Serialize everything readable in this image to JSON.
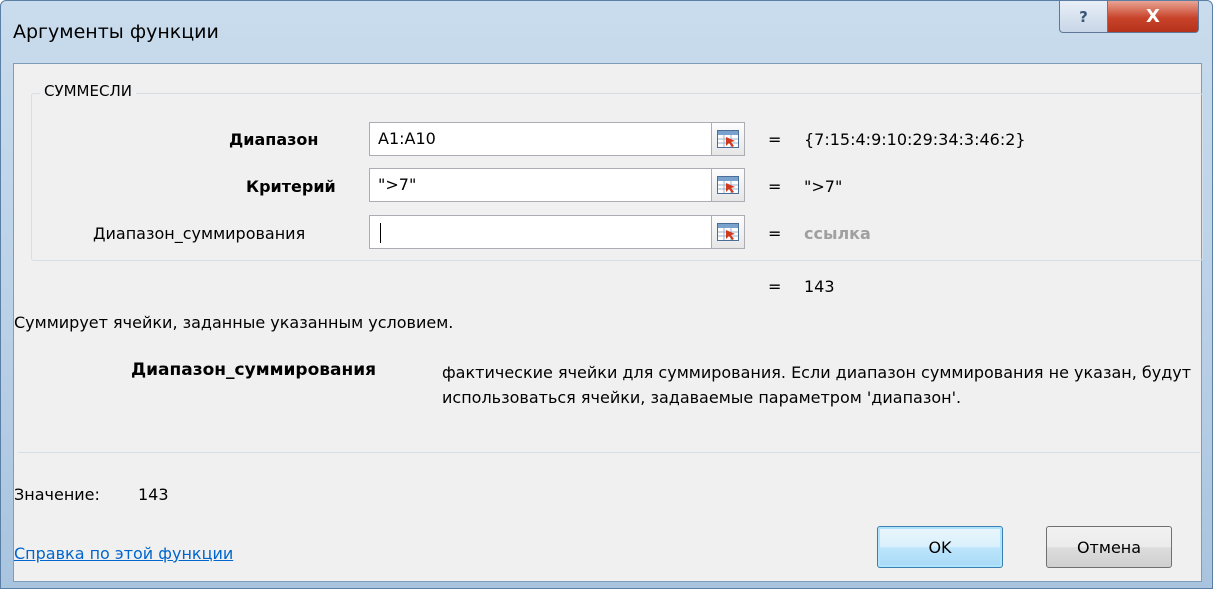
{
  "window": {
    "title": "Аргументы функции",
    "help_glyph": "?",
    "close_glyph": "X"
  },
  "group": {
    "label": "СУММЕСЛИ"
  },
  "arguments": [
    {
      "label": "Диапазон",
      "value": "A1:A10",
      "result": "{7:15:4:9:10:29:34:3:46:2}"
    },
    {
      "label": "Критерий",
      "value": "\">7\"",
      "result": "\">7\""
    },
    {
      "label": "Диапазон_суммирования",
      "value": "",
      "result": "ссылка"
    }
  ],
  "equals_sign": "=",
  "formula_result": "143",
  "function_description": "Суммирует ячейки, заданные указанным условием.",
  "param_help": {
    "name": "Диапазон_суммирования",
    "text": "фактические ячейки для суммирования. Если диапазон суммирования не указан, будут использоваться ячейки, задаваемые параметром 'диапазон'."
  },
  "value_label": "Значение:",
  "value": "143",
  "help_link": "Справка по этой функции",
  "buttons": {
    "ok": "OK",
    "cancel": "Отмена"
  },
  "icons": {
    "collapse": "range-select-icon",
    "help": "help-icon",
    "close": "close-icon"
  }
}
